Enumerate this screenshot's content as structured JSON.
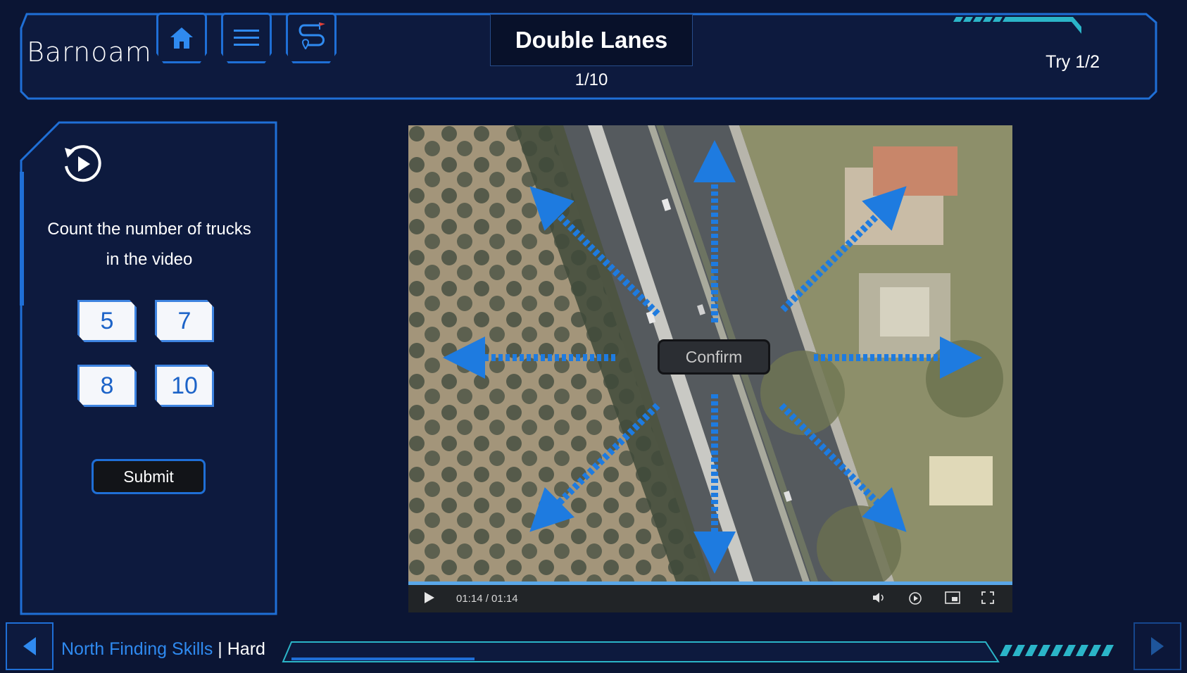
{
  "header": {
    "logo": "Barnoam",
    "title": "Double Lanes",
    "progress": "1/10",
    "try": "Try 1/2"
  },
  "question": {
    "text": "Count the number of trucks in the video",
    "options": [
      "5",
      "7",
      "8",
      "10"
    ],
    "submit_label": "Submit"
  },
  "video": {
    "confirm_label": "Confirm",
    "time": "01:14 / 01:14",
    "played_fraction": 1.0
  },
  "footer": {
    "category": "North Finding Skills",
    "separator": " | ",
    "difficulty": "Hard",
    "progress_fraction": 0.1
  },
  "colors": {
    "background": "#0b1534",
    "accent": "#1f6fd6",
    "arrow": "#1e7be0",
    "teal": "#2bb5c8"
  }
}
